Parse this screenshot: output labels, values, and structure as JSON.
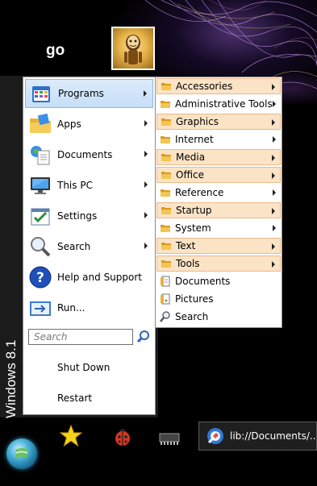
{
  "user": {
    "name": "go"
  },
  "os_label": "Windows 8.1",
  "menu": {
    "items": [
      {
        "label": "Programs",
        "icon": "programs-icon",
        "has_submenu": true,
        "selected": true
      },
      {
        "label": "Apps",
        "icon": "apps-icon",
        "has_submenu": true
      },
      {
        "label": "Documents",
        "icon": "documents-icon",
        "has_submenu": true
      },
      {
        "label": "This PC",
        "icon": "this-pc-icon",
        "has_submenu": true
      },
      {
        "label": "Settings",
        "icon": "settings-icon",
        "has_submenu": true
      },
      {
        "label": "Search",
        "icon": "search-icon",
        "has_submenu": true
      },
      {
        "label": "Help and Support",
        "icon": "help-icon",
        "has_submenu": false
      },
      {
        "label": "Run...",
        "icon": "run-icon",
        "has_submenu": false
      }
    ],
    "search_placeholder": "Search",
    "shutdown_label": "Shut Down",
    "restart_label": "Restart"
  },
  "programs_submenu": {
    "items": [
      {
        "label": "Accessories",
        "icon": "folder-icon",
        "has_submenu": true,
        "highlighted": true
      },
      {
        "label": "Administrative Tools",
        "icon": "folder-icon",
        "has_submenu": true,
        "highlighted": false
      },
      {
        "label": "Graphics",
        "icon": "folder-icon",
        "has_submenu": true,
        "highlighted": true
      },
      {
        "label": "Internet",
        "icon": "folder-icon",
        "has_submenu": true,
        "highlighted": false
      },
      {
        "label": "Media",
        "icon": "folder-icon",
        "has_submenu": true,
        "highlighted": true
      },
      {
        "label": "Office",
        "icon": "folder-icon",
        "has_submenu": true,
        "highlighted": true
      },
      {
        "label": "Reference",
        "icon": "folder-icon",
        "has_submenu": true,
        "highlighted": false
      },
      {
        "label": "Startup",
        "icon": "folder-icon",
        "has_submenu": true,
        "highlighted": true
      },
      {
        "label": "System",
        "icon": "folder-icon",
        "has_submenu": true,
        "highlighted": false
      },
      {
        "label": "Text",
        "icon": "folder-icon",
        "has_submenu": true,
        "highlighted": true
      },
      {
        "label": "Tools",
        "icon": "folder-icon",
        "has_submenu": true,
        "highlighted": true
      },
      {
        "label": "Documents",
        "icon": "document-file-icon",
        "has_submenu": false,
        "highlighted": false
      },
      {
        "label": "Pictures",
        "icon": "picture-file-icon",
        "has_submenu": false,
        "highlighted": false
      },
      {
        "label": "Search",
        "icon": "search-file-icon",
        "has_submenu": false,
        "highlighted": false
      }
    ]
  },
  "taskbar": {
    "pinned": [
      {
        "icon": "star-icon"
      },
      {
        "icon": "ladybug-icon"
      },
      {
        "icon": "chip-icon"
      }
    ],
    "task": {
      "label": "lib://Documents/...",
      "icon": "explorer-icon"
    }
  },
  "colors": {
    "selected_bg": "#c6def8",
    "highlight_bg": "#fbe3c6",
    "folder": "#e8b23a"
  }
}
